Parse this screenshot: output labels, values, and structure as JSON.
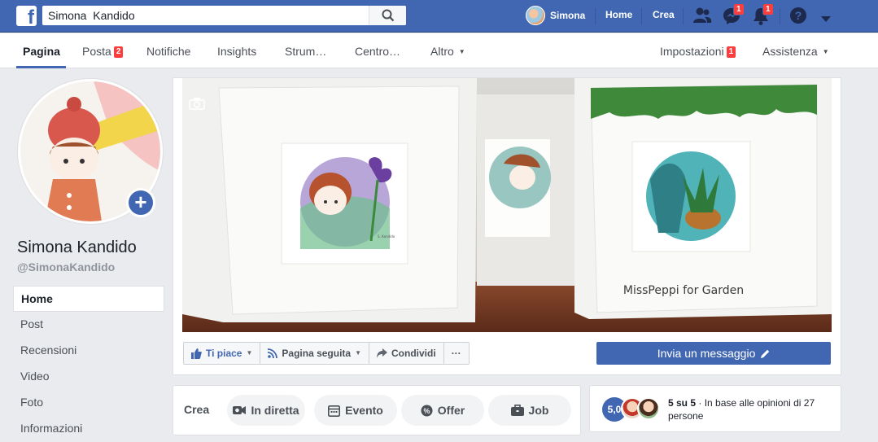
{
  "topbar": {
    "search_value": "Simona  Kandido",
    "user_name": "Simona",
    "home": "Home",
    "create": "Crea",
    "messenger_badge": "1",
    "notifications_badge": "1"
  },
  "pagenav": {
    "items": [
      "Pagina",
      "Posta",
      "Notifiche",
      "Insights",
      "Strum…",
      "Centro…",
      "Altro"
    ],
    "posta_badge": "2",
    "settings": "Impostazioni",
    "settings_badge": "1",
    "help": "Assistenza"
  },
  "page": {
    "name": "Simona Kandido",
    "handle": "@SimonaKandido"
  },
  "leftnav": [
    "Home",
    "Post",
    "Recensioni",
    "Video",
    "Foto",
    "Informazioni"
  ],
  "cover": {
    "caption": "MissPeppi for Garden",
    "signature": "S. Kandido"
  },
  "actions": {
    "like": "Ti piace",
    "following": "Pagina seguita",
    "share": "Condividi",
    "more": "···",
    "message": "Invia un messaggio"
  },
  "crea": {
    "label": "Crea",
    "live": "In diretta",
    "event": "Evento",
    "offer": "Offer",
    "job": "Job"
  },
  "rating": {
    "score": "5,0",
    "headline": "5 su 5",
    "sep": " · ",
    "text": "In base alle opinioni di 27 persone"
  },
  "colors": {
    "brand": "#4267b2",
    "badge": "#fa3e3e",
    "background": "#e9ebee"
  }
}
